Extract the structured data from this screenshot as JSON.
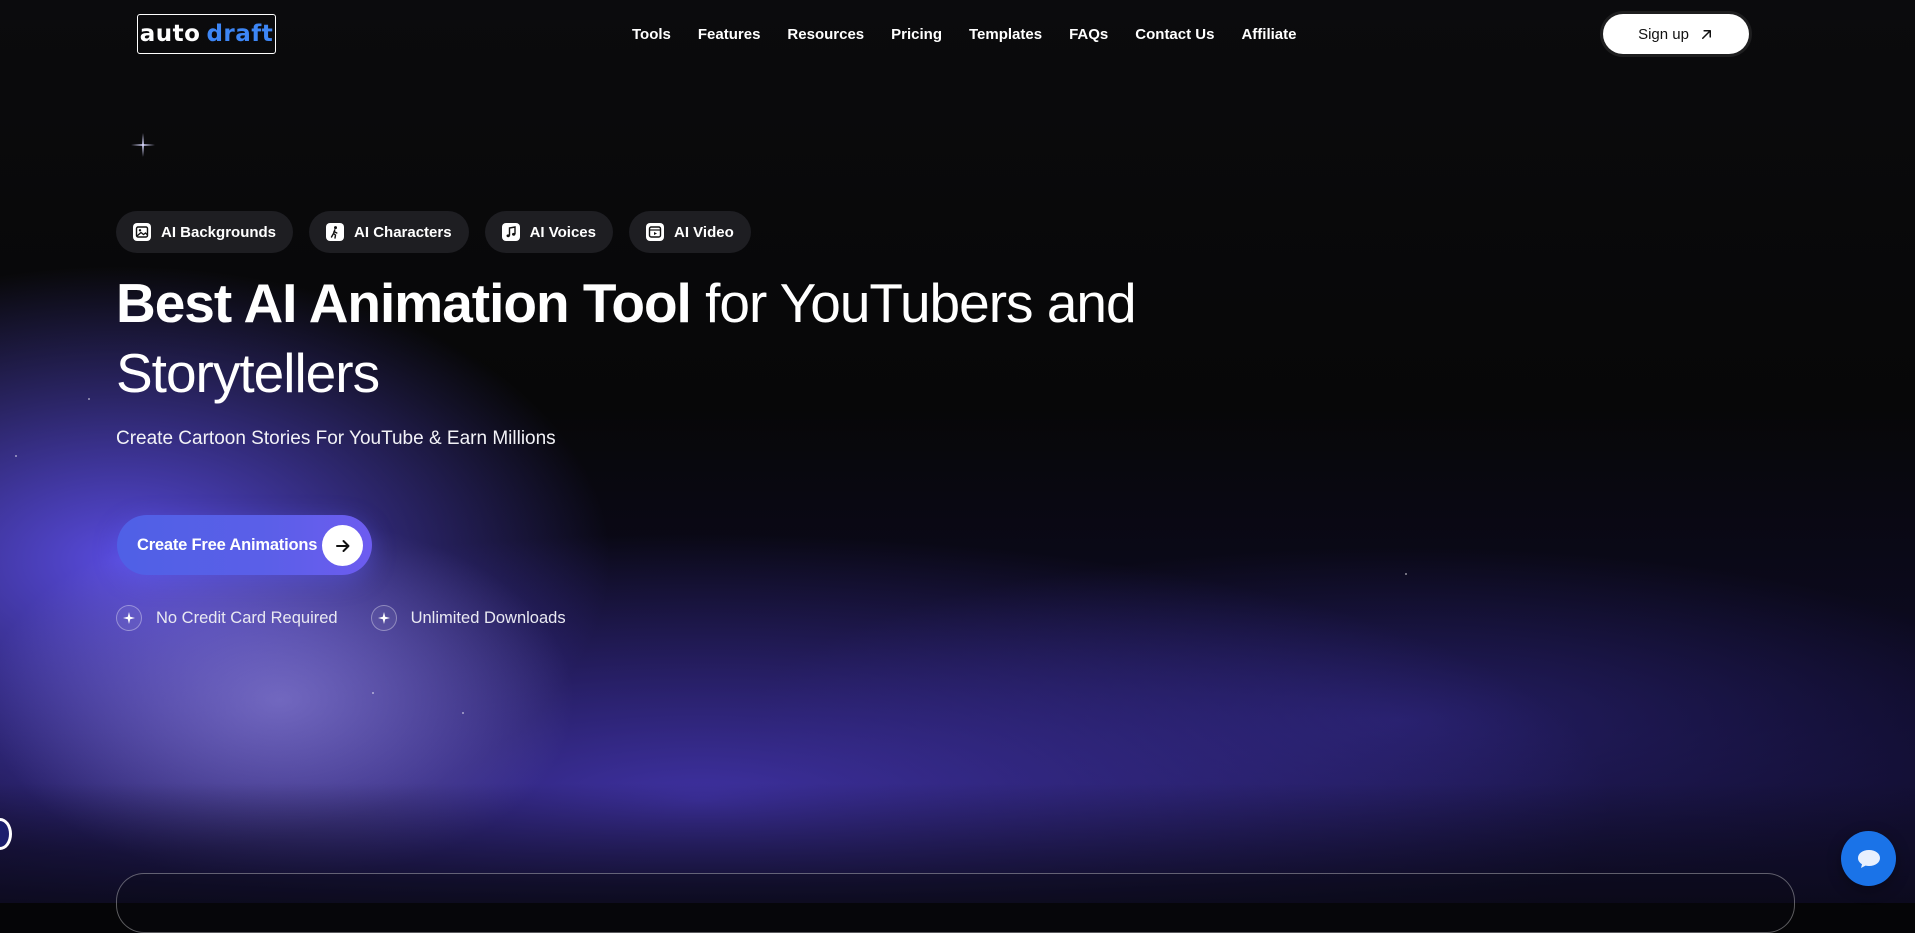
{
  "header": {
    "logo": {
      "word1": "auto",
      "word2": "draft"
    },
    "nav": [
      "Tools",
      "Features",
      "Resources",
      "Pricing",
      "Templates",
      "FAQs",
      "Contact Us",
      "Affiliate"
    ],
    "signup_label": "Sign up"
  },
  "hero": {
    "chips": [
      {
        "label": "AI Backgrounds",
        "icon": "image-icon"
      },
      {
        "label": "AI Characters",
        "icon": "character-icon"
      },
      {
        "label": "AI Voices",
        "icon": "music-note-icon"
      },
      {
        "label": "AI Video",
        "icon": "video-icon"
      }
    ],
    "headline_strong": "Best AI Animation Tool",
    "headline_rest": " for YouTubers and Storytellers",
    "subtitle": "Create Cartoon Stories For YouTube & Earn Millions",
    "cta_label": "Create Free Animations",
    "features": [
      "No Credit Card Required",
      "Unlimited Downloads"
    ]
  },
  "colors": {
    "accent": "#5b5fe8",
    "logo_accent": "#3d86f5",
    "chat_button": "#1a73e8",
    "background": "#050507"
  }
}
